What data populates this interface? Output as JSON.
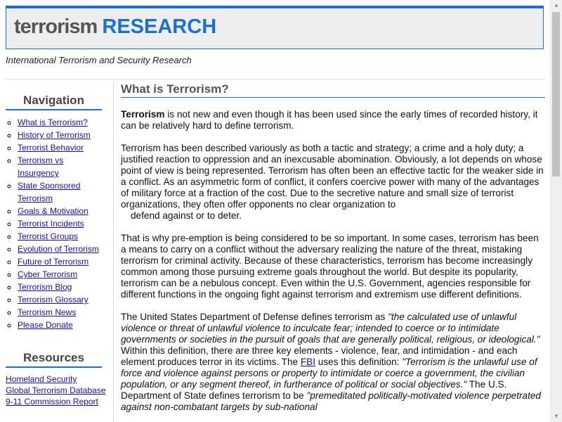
{
  "site": {
    "title_part1": "terrorism",
    "title_part2": "RESEARCH",
    "tagline": "International Terrorism and Security Research"
  },
  "sidebar": {
    "nav_heading": "Navigation",
    "nav_items": [
      "What is Terrorism?",
      "History of Terrorism",
      "Terrorist Behavior",
      "Terrorism vs Insurgency",
      "State Sponsored Terrorism",
      "Goals & Motivation",
      "Terrorist Incidents",
      "Terrorist Groups",
      "Evolution of Terrorism",
      "Future of Terrorism",
      "Cyber Terrorism",
      "Terrorism Blog",
      "Terrorism Glossary",
      "Terrorism News",
      "Please Donate"
    ],
    "resources_heading": "Resources",
    "resource_items": [
      "Homeland Security",
      "Global Terrorism Database",
      "9-11 Commission Report"
    ]
  },
  "main": {
    "title": "What is Terrorism?",
    "p1_bold": "Terrorism",
    "p1_rest": " is not new and even though it has been used since the early times of recorded history, it can be relatively hard to define terrorism.",
    "p2_main": "Terrorism has been described variously as both a tactic and strategy; a crime and a holy duty; a justified reaction to oppression and an inexcusable abomination. Obviously, a lot depends on whose point of view is being represented. Terrorism has often been an effective tactic for the weaker side in a conflict. As an asymmetric form of conflict, it confers coercive power with many of the advantages of military force at a fraction of the cost. Due to the secretive nature and small size of terrorist organizations, they often offer opponents no clear organization to",
    "p2_indent": "defend against or to deter.",
    "p3": "That is why pre-emption is being considered to be so important. In some cases, terrorism has been a means to carry on a conflict without the adversary realizing the nature of the threat, mistaking terrorism for criminal activity. Because of these characteristics, terrorism has become increasingly common among those pursuing extreme goals throughout the world. But despite its popularity, terrorism can be a nebulous concept. Even within the U.S. Government, agencies responsible for different functions in the ongoing fight against terrorism and extremism use different definitions.",
    "p4_a": "The United States Department of Defense defines terrorism as ",
    "p4_quote1": "\"the calculated use of unlawful violence or threat of unlawful violence to inculcate fear; intended to coerce or to intimidate governments or societies in the pursuit of goals that are generally political, religious, or ideological.\"",
    "p4_b": " Within this definition, there are three key elements - violence, fear, and intimidation - and each element produces terror in its victims. The ",
    "p4_link": "FBI",
    "p4_c": " uses this definition: ",
    "p4_quote2": "\"Terrorism is the unlawful use of force and violence against persons or property to intimidate or coerce a government, the civilian population, or any segment thereof, in furtherance of political or social objectives.\"",
    "p4_d": " The U.S. Department of State defines terrorism to be ",
    "p4_quote3": "\"premeditated politically-motivated violence perpetrated against non-combatant targets by sub-national"
  },
  "scrollbar": {
    "up_icon": "▲",
    "down_icon": "▼"
  }
}
